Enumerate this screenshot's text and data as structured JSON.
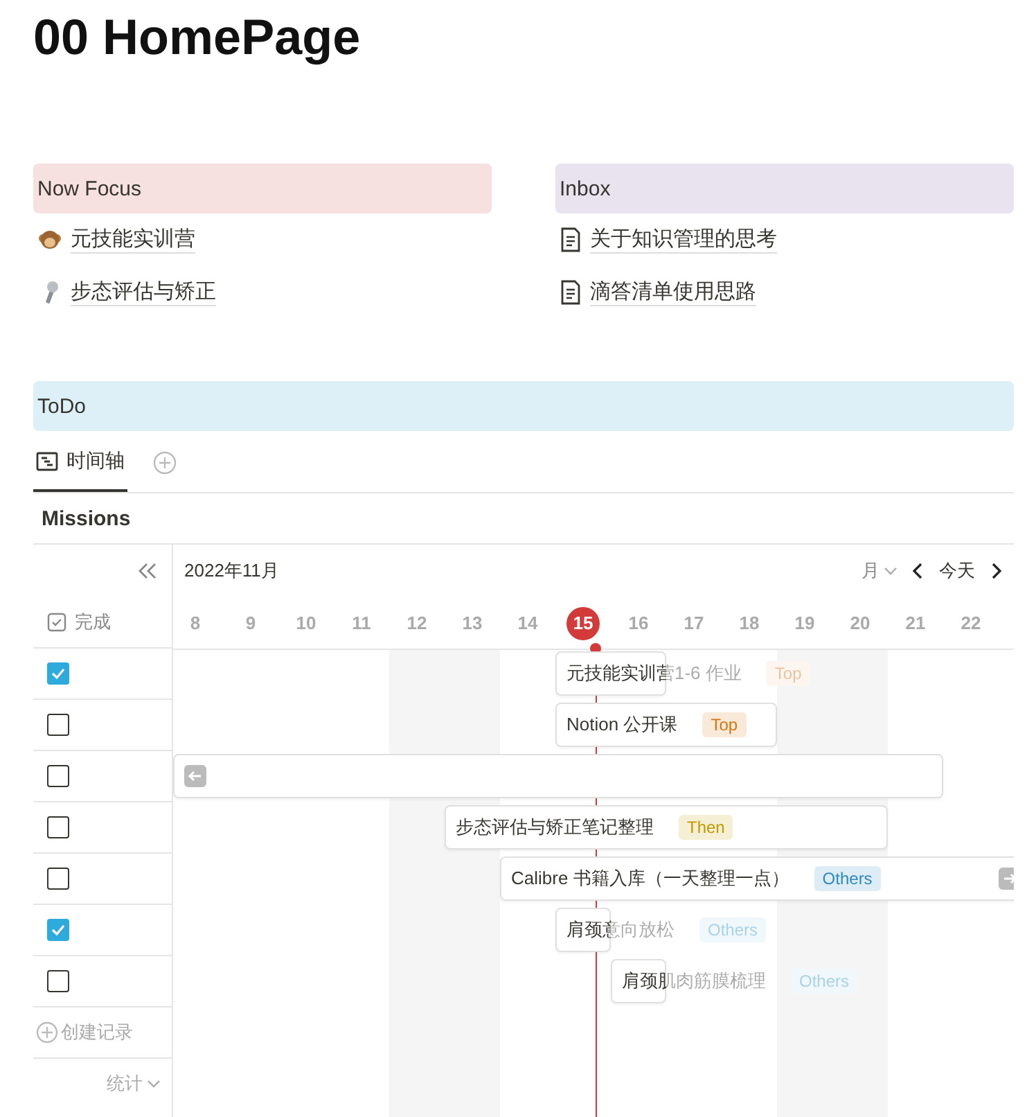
{
  "page_title": "00 HomePage",
  "callouts": [
    {
      "title": "Now Focus",
      "color": "#f6e0e0",
      "items": [
        {
          "kind": "monkey",
          "label": "元技能实训营"
        },
        {
          "kind": "microphone",
          "label": "步态评估与矫正"
        }
      ]
    },
    {
      "title": "Inbox",
      "color": "#e9e3f0",
      "items": [
        {
          "kind": "document",
          "label": "关于知识管理的思考"
        },
        {
          "kind": "document",
          "label": "滴答清单使用思路"
        }
      ]
    }
  ],
  "todo": {
    "title": "ToDo",
    "color": "#ddf0f8"
  },
  "views": [
    {
      "label": "时间轴",
      "selected": true
    }
  ],
  "database_title": "Missions",
  "timeline": {
    "month": "2022年11月",
    "scale": "月",
    "today_button": "今天",
    "property": "完成",
    "days": [
      {
        "label": "8",
        "weekend": false,
        "today": false
      },
      {
        "label": "9",
        "weekend": false,
        "today": false
      },
      {
        "label": "10",
        "weekend": false,
        "today": false
      },
      {
        "label": "11",
        "weekend": false,
        "today": false
      },
      {
        "label": "12",
        "weekend": true,
        "today": false
      },
      {
        "label": "13",
        "weekend": true,
        "today": false
      },
      {
        "label": "14",
        "weekend": false,
        "today": false
      },
      {
        "label": "15",
        "weekend": false,
        "today": true
      },
      {
        "label": "16",
        "weekend": false,
        "today": false
      },
      {
        "label": "17",
        "weekend": false,
        "today": false
      },
      {
        "label": "18",
        "weekend": false,
        "today": false
      },
      {
        "label": "19",
        "weekend": true,
        "today": false
      },
      {
        "label": "20",
        "weekend": true,
        "today": false
      },
      {
        "label": "21",
        "weekend": false,
        "today": false
      },
      {
        "label": "22",
        "weekend": false,
        "today": false
      }
    ],
    "rows": [
      {
        "checked": true,
        "title": "元技能实训营1-6 作业",
        "continues_left": false,
        "continues_right": false,
        "tag": {
          "label": "Top",
          "color": "#ecc3a2"
        }
      },
      {
        "checked": false,
        "title": "Notion 公开课",
        "continues_left": false,
        "continues_right": false,
        "tag": {
          "label": "Top",
          "color": "#d9730d"
        }
      },
      {
        "checked": false,
        "continues_left": true,
        "continues_right": false
      },
      {
        "checked": false,
        "title": "步态评估与矫正笔记整理",
        "continues_left": false,
        "continues_right": false,
        "tag": {
          "label": "Then",
          "color": "#c29a00"
        }
      },
      {
        "checked": false,
        "title": "Calibre 书籍入库（一天整理一点）",
        "continues_left": false,
        "continues_right": true,
        "tag": {
          "label": "Others",
          "color": "#2e8bc0"
        }
      },
      {
        "checked": true,
        "title": "肩颈意向放松",
        "continues_left": false,
        "continues_right": false,
        "tag": {
          "label": "Others",
          "color": "#a9d2ea"
        }
      },
      {
        "checked": false,
        "title": "肩颈肌肉筋膜梳理",
        "continues_left": false,
        "continues_right": false,
        "tag": {
          "label": "Others",
          "color": "#a9d2ea"
        }
      }
    ],
    "create": "创建记录",
    "stats": "统计"
  }
}
